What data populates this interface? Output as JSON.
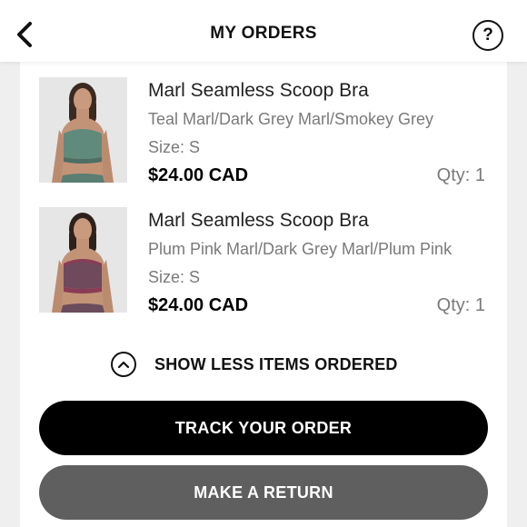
{
  "header": {
    "title": "MY ORDERS",
    "help_label": "?"
  },
  "items": [
    {
      "name": "Marl Seamless Scoop Bra",
      "color": "Teal Marl/Dark Grey Marl/Smokey Grey",
      "size": "Size: S",
      "price": "$24.00 CAD",
      "qty": "Qty: 1"
    },
    {
      "name": "Marl Seamless Scoop Bra",
      "color": "Plum Pink Marl/Dark Grey Marl/Plum Pink",
      "size": "Size: S",
      "price": "$24.00 CAD",
      "qty": "Qty: 1"
    }
  ],
  "toggle": {
    "label": "SHOW LESS ITEMS ORDERED",
    "icon": "chevron-up-circle-icon"
  },
  "actions": {
    "track_label": "TRACK YOUR ORDER",
    "return_label": "MAKE A RETURN"
  },
  "colors": {
    "primary_button": "#000000",
    "secondary_button": "#5f5f60",
    "page_background": "#efefef",
    "muted_text": "#7a7a7a",
    "product_1_tint": "#5f8a7c",
    "product_2_tint": "#6e4a5c"
  }
}
